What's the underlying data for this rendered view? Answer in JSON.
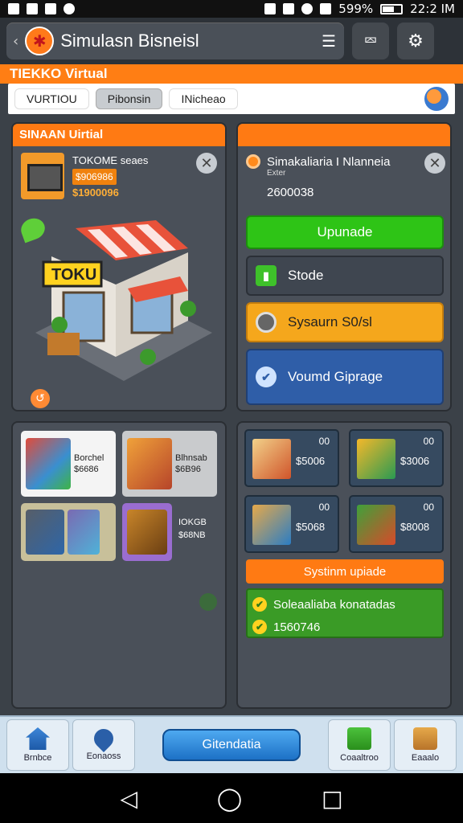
{
  "status_bar": {
    "battery": "599%",
    "time": "22:2 IM"
  },
  "app_bar": {
    "title": "Simulasn Bisneisl"
  },
  "banner": {
    "text": "TIEKKO Virtual"
  },
  "tabs": [
    {
      "label": "VURTIOU",
      "active": false
    },
    {
      "label": "Pibonsin",
      "active": true
    },
    {
      "label": "INicheao",
      "active": false
    }
  ],
  "store_panel": {
    "header": "SINAAN Uirtial",
    "card_name": "TOKOME seaes",
    "card_price": "$906986",
    "card_cash": "$1900096",
    "sign_text": "TOKU"
  },
  "action_panel": {
    "header": "",
    "name": "Simakaliaria I Nlanneia",
    "sub": "Exter",
    "amount": "2600038",
    "buttons": {
      "upgrade": "Upunade",
      "stock": "Stode",
      "system": "Sysaurn S0/sl",
      "upgrade_blue": "Voumd Giprage"
    }
  },
  "items_panel": {
    "items": [
      {
        "title": "Borchel",
        "price": "$6686"
      },
      {
        "title": "Blhnsab",
        "price": "$6B96"
      },
      {
        "title": "",
        "price": ""
      },
      {
        "title": "IOKGB",
        "price": "$68NB"
      }
    ]
  },
  "shop_panel": {
    "items": [
      {
        "price": "$5006",
        "tag": "00"
      },
      {
        "price": "$3006",
        "tag": "00"
      },
      {
        "price": "$5068",
        "tag": "00"
      },
      {
        "price": "$8008",
        "tag": "00"
      }
    ],
    "system_bar": "Systinm upiade",
    "system_rows": [
      "Soleaaliaba konatadas",
      "1560746"
    ]
  },
  "bottom_nav": {
    "left1": "Brnbce",
    "left2": "Eonaoss",
    "center": "Gitendatia",
    "right1": "Coaaltroo",
    "right2": "Eaaalo"
  },
  "colors": {
    "accent": "#ff7a13",
    "primary_green": "#2ec416",
    "primary_blue": "#2f5ea8"
  }
}
